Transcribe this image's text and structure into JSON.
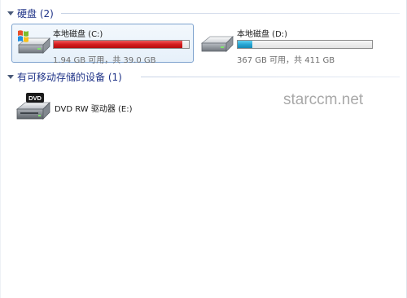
{
  "groups": {
    "hard_disks": {
      "title": "硬盘 (2)"
    },
    "removable": {
      "title": "有可移动存储的设备 (1)"
    }
  },
  "drives": [
    {
      "name": "本地磁盘 (C:)",
      "space_text": "1.94 GB 可用，共 39.0 GB",
      "used_fraction": 0.95,
      "bar_color": "#d41d1d",
      "icon": "windows-drive-icon"
    },
    {
      "name": "本地磁盘 (D:)",
      "space_text": "367 GB 可用，共 411 GB",
      "used_fraction": 0.11,
      "bar_color": "#27a6d4",
      "icon": "hard-drive-icon"
    }
  ],
  "dvd": {
    "name": "DVD RW 驱动器 (E:)",
    "icon": "dvd-drive-icon",
    "icon_label": "DVD"
  },
  "watermark": "starccm.net"
}
